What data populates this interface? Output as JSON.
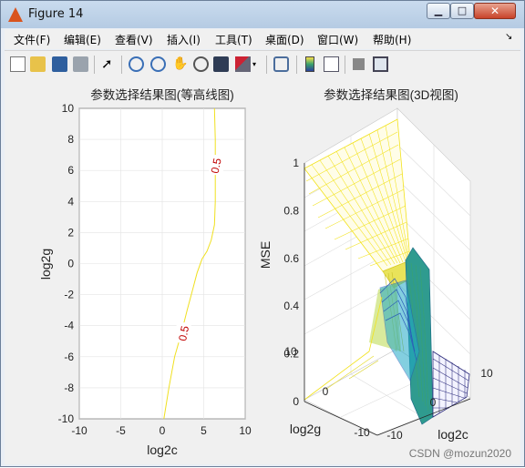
{
  "window": {
    "title": "Figure 14",
    "minimize_glyph": "▁",
    "maximize_glyph": "□",
    "close_glyph": "✕"
  },
  "menu": [
    "文件(F)",
    "编辑(E)",
    "查看(V)",
    "插入(I)",
    "工具(T)",
    "桌面(D)",
    "窗口(W)",
    "帮助(H)"
  ],
  "toolbar": [
    "new-figure-icon",
    "open-file-icon",
    "save-icon",
    "print-icon",
    "pointer-icon",
    "zoom-in-icon",
    "zoom-out-icon",
    "pan-icon",
    "rotate-3d-icon",
    "data-cursor-icon",
    "brush-icon",
    "link-plot-icon",
    "colorbar-icon",
    "legend-icon",
    "hide-plot-tools-icon",
    "show-plot-tools-icon"
  ],
  "watermark": "CSDN @mozun2020",
  "chart_data": [
    {
      "type": "line",
      "title": "参数选择结果图(等高线图)",
      "xlabel": "log2c",
      "ylabel": "log2g",
      "xlim": [
        -10,
        10
      ],
      "ylim": [
        -10,
        10
      ],
      "xticks": [
        "-10",
        "-5",
        "0",
        "5",
        "10"
      ],
      "yticks": [
        "10",
        "8",
        "6",
        "4",
        "2",
        "0",
        "-2",
        "-4",
        "-6",
        "-8",
        "-10"
      ],
      "grid": true,
      "series": [
        {
          "color": "#f0e020",
          "x": [
            0.2,
            0.8,
            1.5,
            2.3,
            3.0,
            3.6,
            4.2,
            4.8,
            5.4,
            5.9,
            6.3,
            6.4,
            6.4,
            6.4,
            6.3
          ],
          "y": [
            -10,
            -8,
            -6,
            -4.5,
            -3,
            -1.8,
            -0.6,
            0.3,
            0.8,
            1.5,
            2.5,
            4,
            6,
            8,
            10
          ]
        }
      ],
      "annotations": [
        {
          "text": "0.5",
          "x": 6.5,
          "y": 6.3
        },
        {
          "text": "0.5",
          "x": 2.6,
          "y": -4.5
        }
      ],
      "annotation_color": "#c00000"
    },
    {
      "type": "surface",
      "title": "参数选择结果图(3D视图)",
      "zlabel": "MSE",
      "xlabel": "log2c",
      "ylabel": "log2g",
      "zticks": [
        "0",
        "0.2",
        "0.4",
        "0.6",
        "0.8",
        "1"
      ],
      "xticks": [
        "-10",
        "0",
        "10"
      ],
      "yticks": [
        "-10",
        "0",
        "10"
      ],
      "zlim": [
        0,
        1
      ]
    }
  ]
}
